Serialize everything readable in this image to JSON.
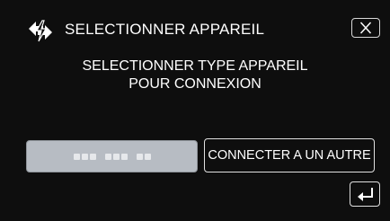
{
  "header": {
    "title": "SELECTIONNER APPAREIL",
    "icon": "wireless-connection-icon",
    "close_icon": "close-icon"
  },
  "message": {
    "line1": "SELECTIONNER TYPE APPAREIL",
    "line2": "POUR CONNEXION"
  },
  "device_button": {
    "state": "disabled",
    "icon": "placeholder-dots"
  },
  "connect_button": {
    "label": "CONNECTER A UN AUTRE"
  },
  "back_button": {
    "icon": "back-arrow-icon"
  },
  "colors": {
    "background": "#0e0e0e",
    "text": "#ffffff",
    "disabled_button": "#b7bcc3"
  }
}
